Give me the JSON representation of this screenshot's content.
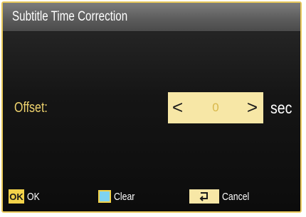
{
  "dialog": {
    "title": "Subtitle Time Correction"
  },
  "offset": {
    "label": "Offset:",
    "value": "0",
    "unit": "sec",
    "left_arrow": "<",
    "right_arrow": ">"
  },
  "footer": {
    "ok": {
      "key": "OK",
      "label": "OK"
    },
    "clear": {
      "label": "Clear",
      "key_color": "#7ed3f0"
    },
    "cancel": {
      "label": "Cancel",
      "icon": "return-arrow-icon"
    }
  },
  "colors": {
    "accent_border": "#e8c85a",
    "field_bg": "#f7e7a6",
    "label_gold": "#f0d46e",
    "ok_key": "#f2d24a"
  }
}
